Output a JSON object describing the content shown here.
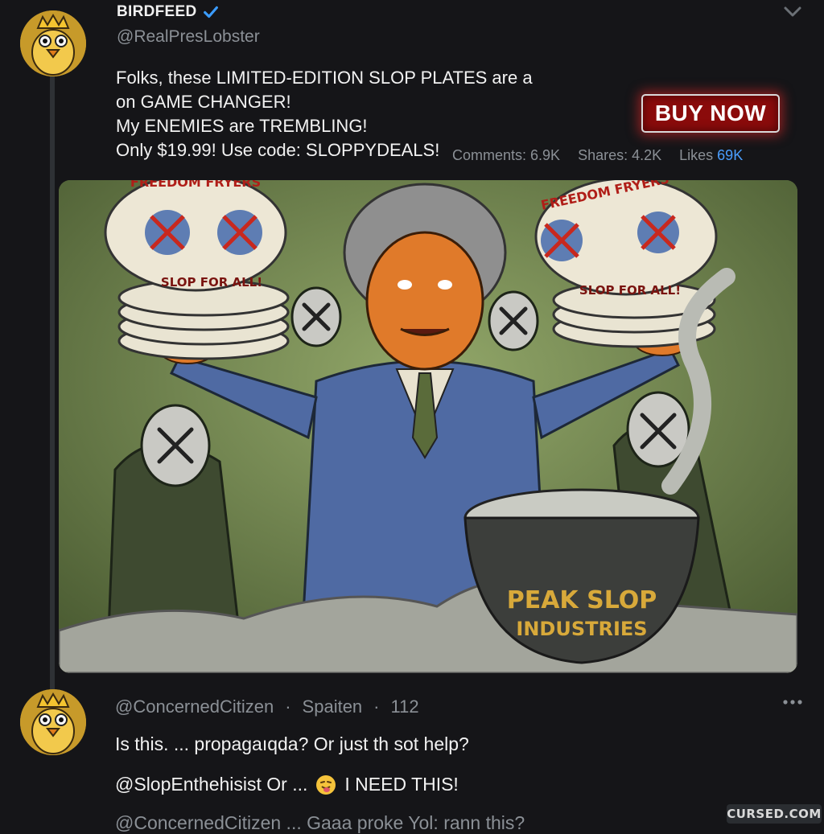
{
  "post": {
    "author_name": "BIRDFEED",
    "handle": "@RealPresLobster",
    "text_lines": [
      "Folks, these LIMITED-EDITION SLOP PLATES are a",
      "on GAME CHANGER!",
      "My ENEMIES are TREMBLING!",
      "Only $19.99! Use code: SLOPPYDEALS!"
    ],
    "stats": {
      "comments": "Comments: 6.9K",
      "shares": "Shares: 4.2K",
      "likes_label": "Likes",
      "likes_value": "69K"
    },
    "buy_button": "BUY NOW",
    "image": {
      "plate_left_top": "FREEDOM FRYERS",
      "plate_left_bottom": "SLOP FOR ALL!",
      "plate_right_top": "FREEDOM FRYERS",
      "plate_right_bottom": "SLOP FOR ALL!",
      "pot_line1": "PEAK SLOP",
      "pot_line2": "INDUSTRIES"
    }
  },
  "reply": {
    "handle": "@ConcernedCitizen",
    "separator": "·",
    "location": "Spaiten",
    "separator2": "·",
    "count": "112",
    "line1": "Is this. ... propagaıqda? Or just th sot help?",
    "line2_prefix": "@SlopEnthehisist Or ...",
    "line2_suffix": "I NEED THIS!",
    "line3": "@ConcernedCitizen ... Gaaa proke Yol: rann this?"
  },
  "watermark": "CURSED.COM",
  "icons": {
    "verified": "verified-badge-icon",
    "chevron": "chevron-down-icon",
    "more": "more-options-icon",
    "emoji": "tongue-face-emoji"
  },
  "colors": {
    "background": "#151518",
    "accent": "#4a9eff",
    "buy_button": "#8b0b0b",
    "muted_text": "#8b9096"
  }
}
